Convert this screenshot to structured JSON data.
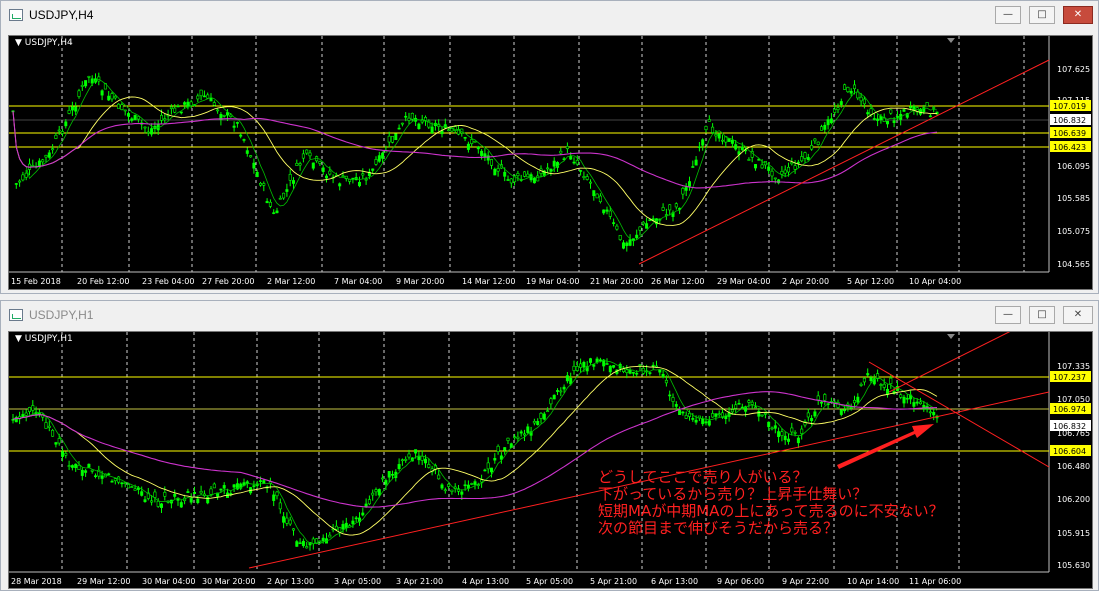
{
  "windows": [
    {
      "title": "USDJPY,H4",
      "symbol_label": "USDJPY,H4",
      "price_axis": [
        "107.625",
        "107.115",
        "106.095",
        "105.585",
        "105.075",
        "104.565"
      ],
      "price_labels": [
        {
          "text": "107.019",
          "color": "#ffff00",
          "kind": "hline"
        },
        {
          "text": "106.832",
          "color": "#ffffff",
          "kind": "current"
        },
        {
          "text": "106.639",
          "color": "#ffff00",
          "kind": "hline"
        },
        {
          "text": "106.423",
          "color": "#ffff00",
          "kind": "hline"
        }
      ],
      "time_axis": [
        "15 Feb 2018",
        "20 Feb 12:00",
        "23 Feb 04:00",
        "27 Feb 20:00",
        "2 Mar 12:00",
        "7 Mar 04:00",
        "9 Mar 20:00",
        "14 Mar 12:00",
        "19 Mar 04:00",
        "21 Mar 20:00",
        "26 Mar 12:00",
        "29 Mar 04:00",
        "2 Apr 20:00",
        "5 Apr 12:00",
        "10 Apr 04:00"
      ]
    },
    {
      "title": "USDJPY,H1",
      "symbol_label": "USDJPY,H1",
      "price_axis": [
        "107.335",
        "107.050",
        "106.765",
        "106.480",
        "106.200",
        "105.915",
        "105.630"
      ],
      "price_labels": [
        {
          "text": "107.237",
          "color": "#ffff00",
          "kind": "hline"
        },
        {
          "text": "106.974",
          "color": "#ffff00",
          "kind": "hline"
        },
        {
          "text": "106.832",
          "color": "#ffffff",
          "kind": "current"
        },
        {
          "text": "106.604",
          "color": "#ffff00",
          "kind": "hline"
        }
      ],
      "time_axis": [
        "28 Mar 2018",
        "29 Mar 12:00",
        "30 Mar 04:00",
        "30 Mar 20:00",
        "2 Apr 13:00",
        "3 Apr 05:00",
        "3 Apr 21:00",
        "4 Apr 13:00",
        "5 Apr 05:00",
        "5 Apr 21:00",
        "6 Apr 13:00",
        "9 Apr 06:00",
        "9 Apr 22:00",
        "10 Apr 14:00",
        "11 Apr 06:00"
      ]
    }
  ],
  "window_buttons": {
    "minimize": "—",
    "maximize": "□",
    "close": "✕"
  },
  "annotation": "どうしてここで売り人がいる？\n下がっているから売り？上昇手仕舞い？\n短期MAが中期MAの上にあって売るのに不安ない？\n次の節目まで伸びそうだから売る？",
  "colors": {
    "bull": "#00ff00",
    "bear": "#00ff00",
    "ma_short": "#00c000",
    "ma_mid": "#ffff66",
    "ma_long": "#cc33cc",
    "hline": "#ffff00",
    "trend": "#ff2020",
    "annotation": "#ff2020"
  }
}
